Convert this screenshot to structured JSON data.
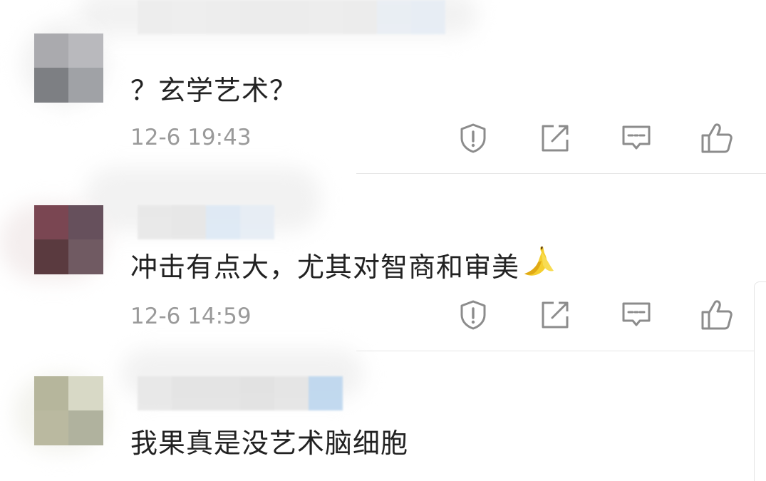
{
  "comments": [
    {
      "text": "？玄学艺术？",
      "time": "12-6 19:43",
      "avatar_colors": [
        "#aaaaae",
        "#b9b9bd",
        "#7d7f83",
        "#a0a2a6"
      ],
      "name_colors": [
        "#ededed",
        "#eeeeee",
        "#ededed",
        "#ececec",
        "#ececec",
        "#ededed",
        "#ececec",
        "#e9eef4",
        "#e6edf5"
      ],
      "emoji": ""
    },
    {
      "text": "冲击有点大，尤其对智商和审美",
      "time": "12-6 14:59",
      "avatar_colors": [
        "#7a4652",
        "#66505c",
        "#5a3a3f",
        "#705a62"
      ],
      "name_colors": [
        "#e8e8e8",
        "#e6e6e6",
        "#dde9f5",
        "#e6edf5"
      ],
      "emoji": "banana"
    },
    {
      "text": "我果真是没艺术脑细胞",
      "time": "",
      "avatar_colors": [
        "#b6b69c",
        "#d8d9c6",
        "#bab9a0",
        "#b0b29e"
      ],
      "name_colors": [
        "#e7e7e7",
        "#e3e3e3",
        "#e3e3e3",
        "#e1e1e1",
        "#e4e4e4",
        "#bcd6ee"
      ],
      "emoji": ""
    }
  ],
  "actions": {
    "report_icon": "shield-exclamation-icon",
    "share_icon": "share-box-arrow-icon",
    "reply_icon": "comment-bubble-icon",
    "like_icon": "thumbs-up-icon"
  },
  "colors": {
    "text": "#222222",
    "timestamp": "#9a9a9a",
    "icon": "#8c8c8c"
  }
}
